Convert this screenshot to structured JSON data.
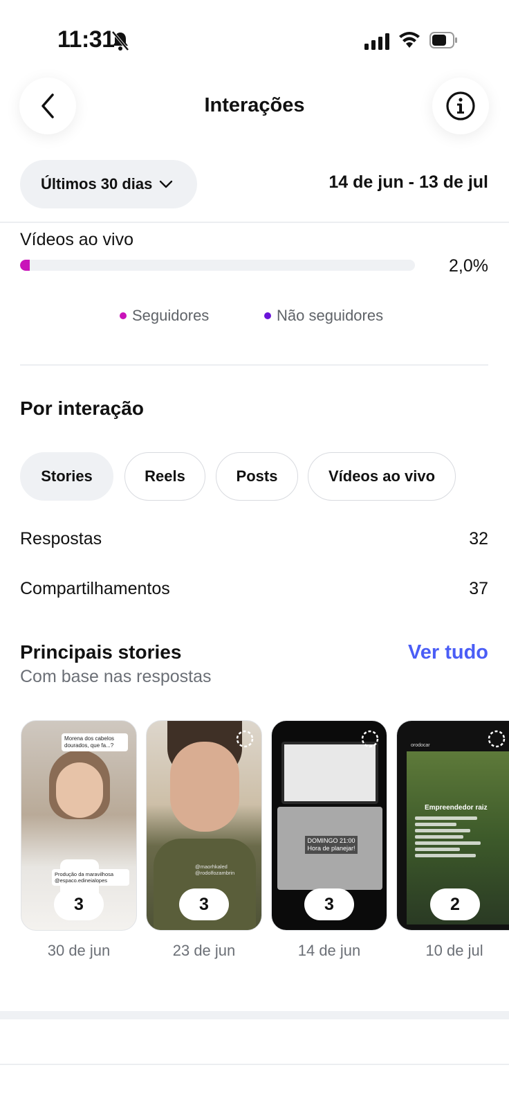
{
  "status_bar": {
    "time": "11:31"
  },
  "header": {
    "title": "Interações"
  },
  "filter": {
    "period": "Últimos 30 dias",
    "date_range": "14 de jun - 13 de jul"
  },
  "live_videos": {
    "label": "Vídeos ao vivo",
    "value": "2,0%",
    "fraction": 0.02
  },
  "legend": {
    "followers": "Seguidores",
    "non_followers": "Não seguidores",
    "followers_color": "#c913b9",
    "non_followers_color": "#6a14d9"
  },
  "by_interaction": {
    "title": "Por interação",
    "tabs": [
      {
        "label": "Stories",
        "active": true
      },
      {
        "label": "Reels",
        "active": false
      },
      {
        "label": "Posts",
        "active": false
      },
      {
        "label": "Vídeos ao vivo",
        "active": false
      }
    ],
    "metrics": [
      {
        "label": "Respostas",
        "value": "32"
      },
      {
        "label": "Compartilhamentos",
        "value": "37"
      }
    ]
  },
  "top_stories": {
    "title": "Principais stories",
    "see_all": "Ver tudo",
    "subtitle": "Com base nas respostas",
    "items": [
      {
        "count": "3",
        "date": "30 de jun",
        "caption_top": "Morena dos cabelos dourados, que fa...?",
        "caption_bottom": "Produção da maravilhosa @espaco.edineialopes"
      },
      {
        "count": "3",
        "date": "23 de jun",
        "caption_top": "",
        "caption_bottom": "@maorhkaled @rodolfozambrin"
      },
      {
        "count": "3",
        "date": "14 de jun",
        "caption_top": "",
        "caption_bottom": "DOMINGO 21:00 Hora de planejar!"
      },
      {
        "count": "2",
        "date": "10 de jul",
        "caption_top": "orodocar",
        "caption_bottom": "Empreendedor raiz"
      }
    ]
  },
  "colors": {
    "accent": "#4a5df6",
    "chip_bg": "#eff1f4"
  }
}
